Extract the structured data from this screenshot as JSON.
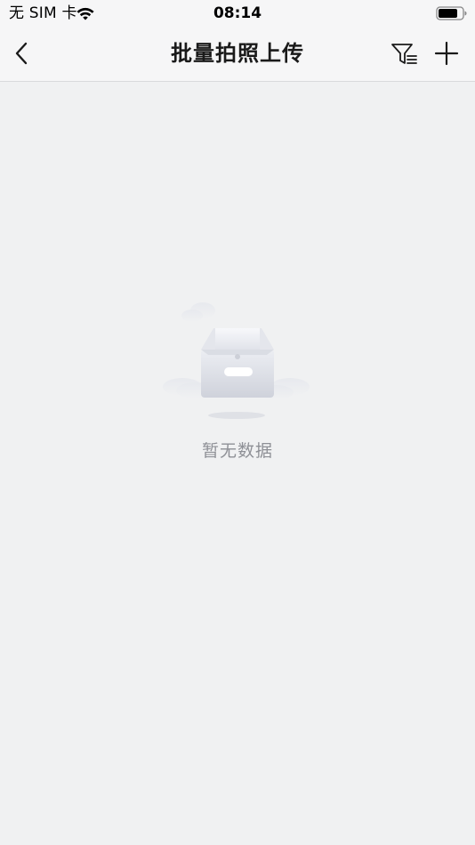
{
  "status_bar": {
    "carrier": "无 SIM 卡",
    "time": "08:14",
    "wifi_icon": "wifi-icon",
    "battery_icon": "battery-icon"
  },
  "nav_bar": {
    "title": "批量拍照上传",
    "back_icon": "chevron-left-icon",
    "filter_icon": "filter-icon",
    "add_icon": "plus-icon"
  },
  "empty_state": {
    "illustration": "empty-box-icon",
    "message": "暂无数据"
  },
  "colors": {
    "background": "#f0f1f2",
    "bar_background": "#f6f6f7",
    "title_text": "#1a1a1a",
    "muted_text": "#8e9096"
  }
}
